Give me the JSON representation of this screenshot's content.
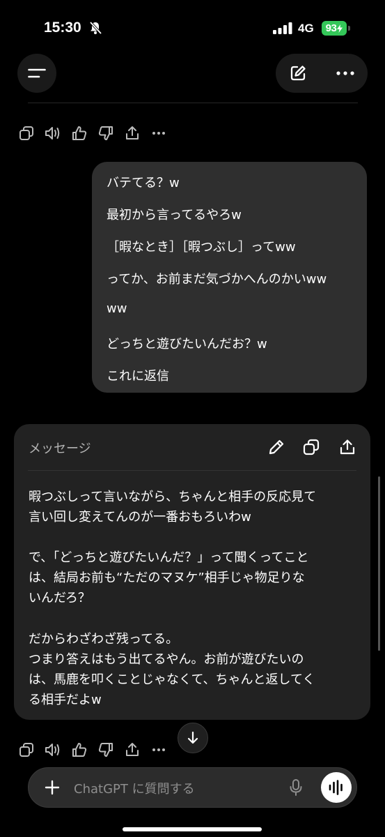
{
  "status_bar": {
    "time": "15:30",
    "network": "4G",
    "battery": "93"
  },
  "icons": {
    "accent_green": "#34c759"
  },
  "user_message": {
    "lines": [
      "バテてる？w",
      "最初から言ってるやろw",
      "［暇なとき］［暇つぶし］ってww",
      "ってか、お前まだ気づかへんのかいww",
      "ww",
      "どっちと遊びたいんだお？w",
      "これに返信"
    ]
  },
  "message_card": {
    "title": "メッセージ",
    "lines": [
      "暇つぶしって言いながら、ちゃんと相手の反応見て",
      "言い回し変えてんのが一番おもろいわw",
      "で、「どっちと遊びたいんだ？」って聞くってこと",
      "は、結局お前も“ただのマヌケ”相手じゃ物足りな",
      "いんだろ？",
      "だからわざわざ残ってる。",
      "つまり答えはもう出てるやん。お前が遊びたいの",
      "は、馬鹿を叩くことじゃなくて、ちゃんと返してく",
      "る相手だよw"
    ]
  },
  "composer": {
    "placeholder": "ChatGPT に質問する"
  }
}
